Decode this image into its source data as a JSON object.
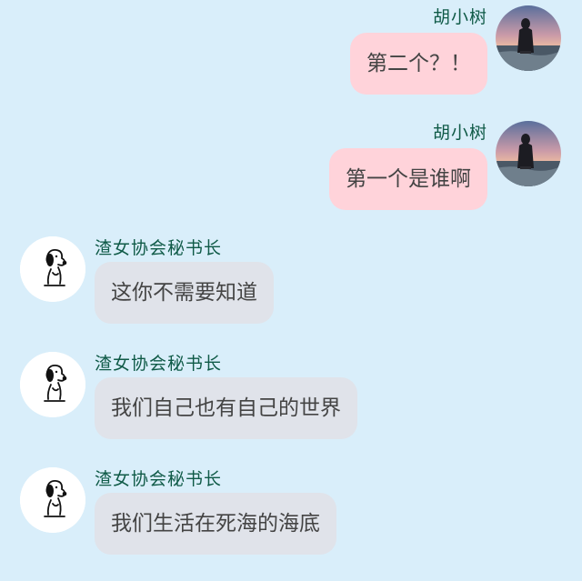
{
  "messages": [
    {
      "side": "out",
      "sender": "胡小树",
      "text": "第二个？！",
      "avatar": "photo-avatar"
    },
    {
      "side": "out",
      "sender": "胡小树",
      "text": "第一个是谁啊",
      "avatar": "photo-avatar"
    },
    {
      "side": "in",
      "sender": "渣女协会秘书长",
      "text": "这你不需要知道",
      "avatar": "snoopy-avatar"
    },
    {
      "side": "in",
      "sender": "渣女协会秘书长",
      "text": "我们自己也有自己的世界",
      "avatar": "snoopy-avatar"
    },
    {
      "side": "in",
      "sender": "渣女协会秘书长",
      "text": "我们生活在死海的海底",
      "avatar": "snoopy-avatar"
    }
  ],
  "colors": {
    "background": "#d9eefa",
    "outgoing_bubble": "#ffd3da",
    "incoming_bubble": "#e0e3ea",
    "sender_name": "#0f5a47",
    "message_text": "#444444"
  }
}
